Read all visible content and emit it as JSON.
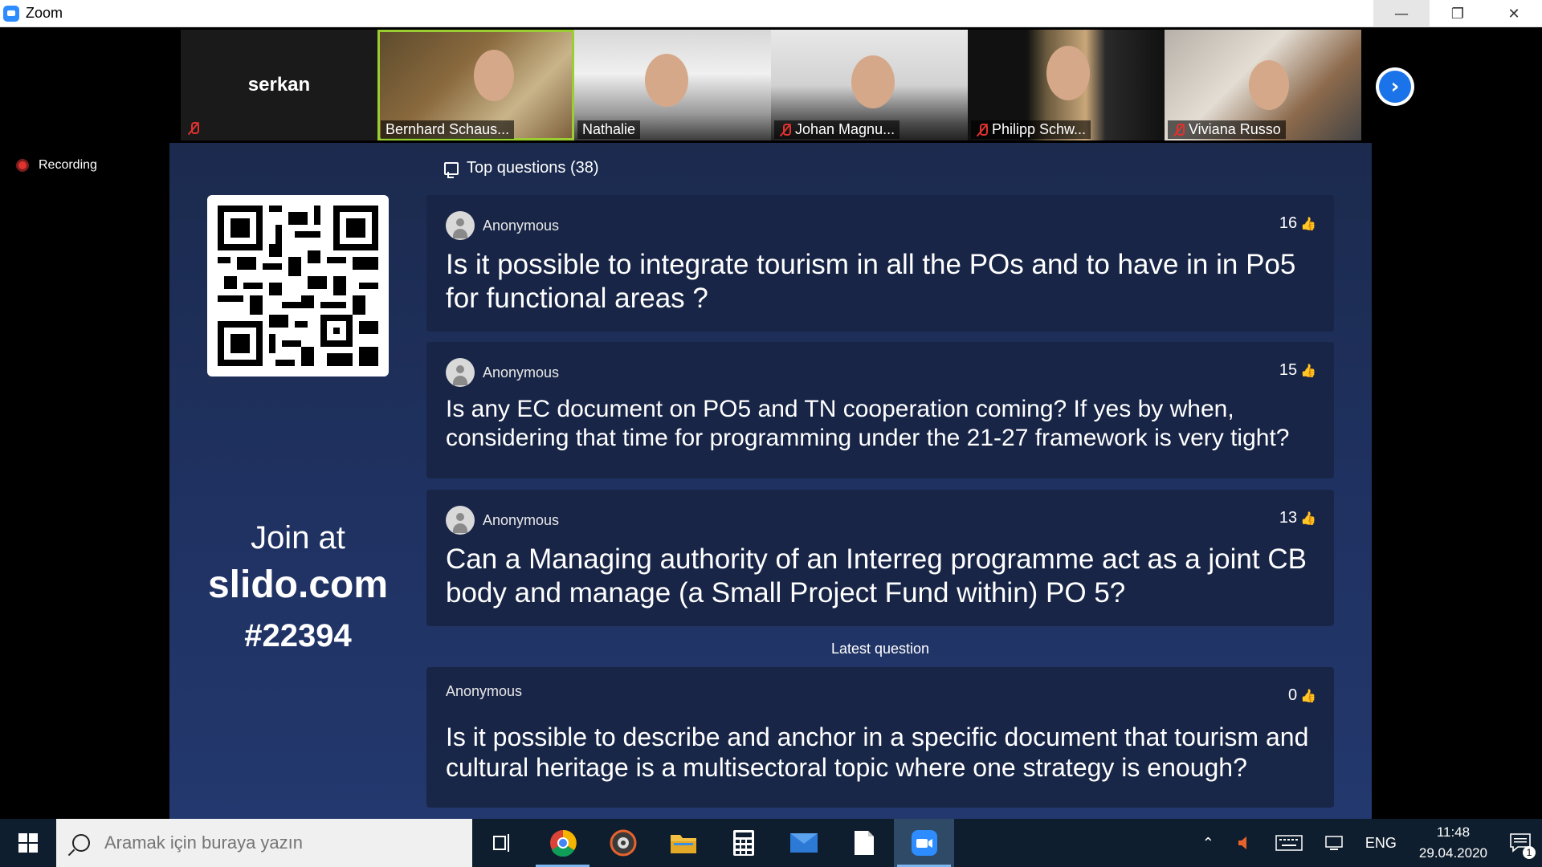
{
  "window": {
    "title": "Zoom"
  },
  "participants": [
    {
      "name": "serkan",
      "muted": true,
      "video": false
    },
    {
      "name": "Bernhard Schaus...",
      "muted": false,
      "video": true,
      "active": true
    },
    {
      "name": "Nathalie",
      "muted": false,
      "video": true
    },
    {
      "name": "Johan Magnu...",
      "muted": true,
      "video": true
    },
    {
      "name": "Philipp Schw...",
      "muted": true,
      "video": true
    },
    {
      "name": "Viviana Russo",
      "muted": true,
      "video": true
    }
  ],
  "recording": {
    "label": "Recording"
  },
  "slido": {
    "join": {
      "line1": "Join at",
      "line2": "slido.com",
      "line3": "#22394"
    },
    "top_questions_label": "Top questions (38)",
    "questions": [
      {
        "author": "Anonymous",
        "likes": "16",
        "text": "Is it possible to integrate tourism in all the POs and to have in in Po5 for functional areas ?"
      },
      {
        "author": "Anonymous",
        "likes": "15",
        "text": "Is any EC document on PO5 and TN cooperation coming? If yes by when, considering that time for programming under the 21-27 framework is very tight?"
      },
      {
        "author": "Anonymous",
        "likes": "13",
        "text": "Can a Managing authority of an Interreg programme act as a joint CB body and manage (a Small Project Fund within) PO 5?"
      }
    ],
    "latest_label": "Latest question",
    "latest": {
      "author": "Anonymous",
      "likes": "0",
      "text": "Is it possible to describe and anchor in a specific document that tourism and cultural heritage is a multisectoral topic where one strategy is enough?"
    }
  },
  "taskbar": {
    "search_placeholder": "Aramak için buraya yazın",
    "language": "ENG",
    "time": "11:48",
    "date": "29.04.2020",
    "notifications": "1"
  },
  "colors": {
    "accent": "#2d8cff",
    "muted": "#e0322e",
    "active_border": "#9acd32",
    "slido_bg": "#1f3160"
  }
}
